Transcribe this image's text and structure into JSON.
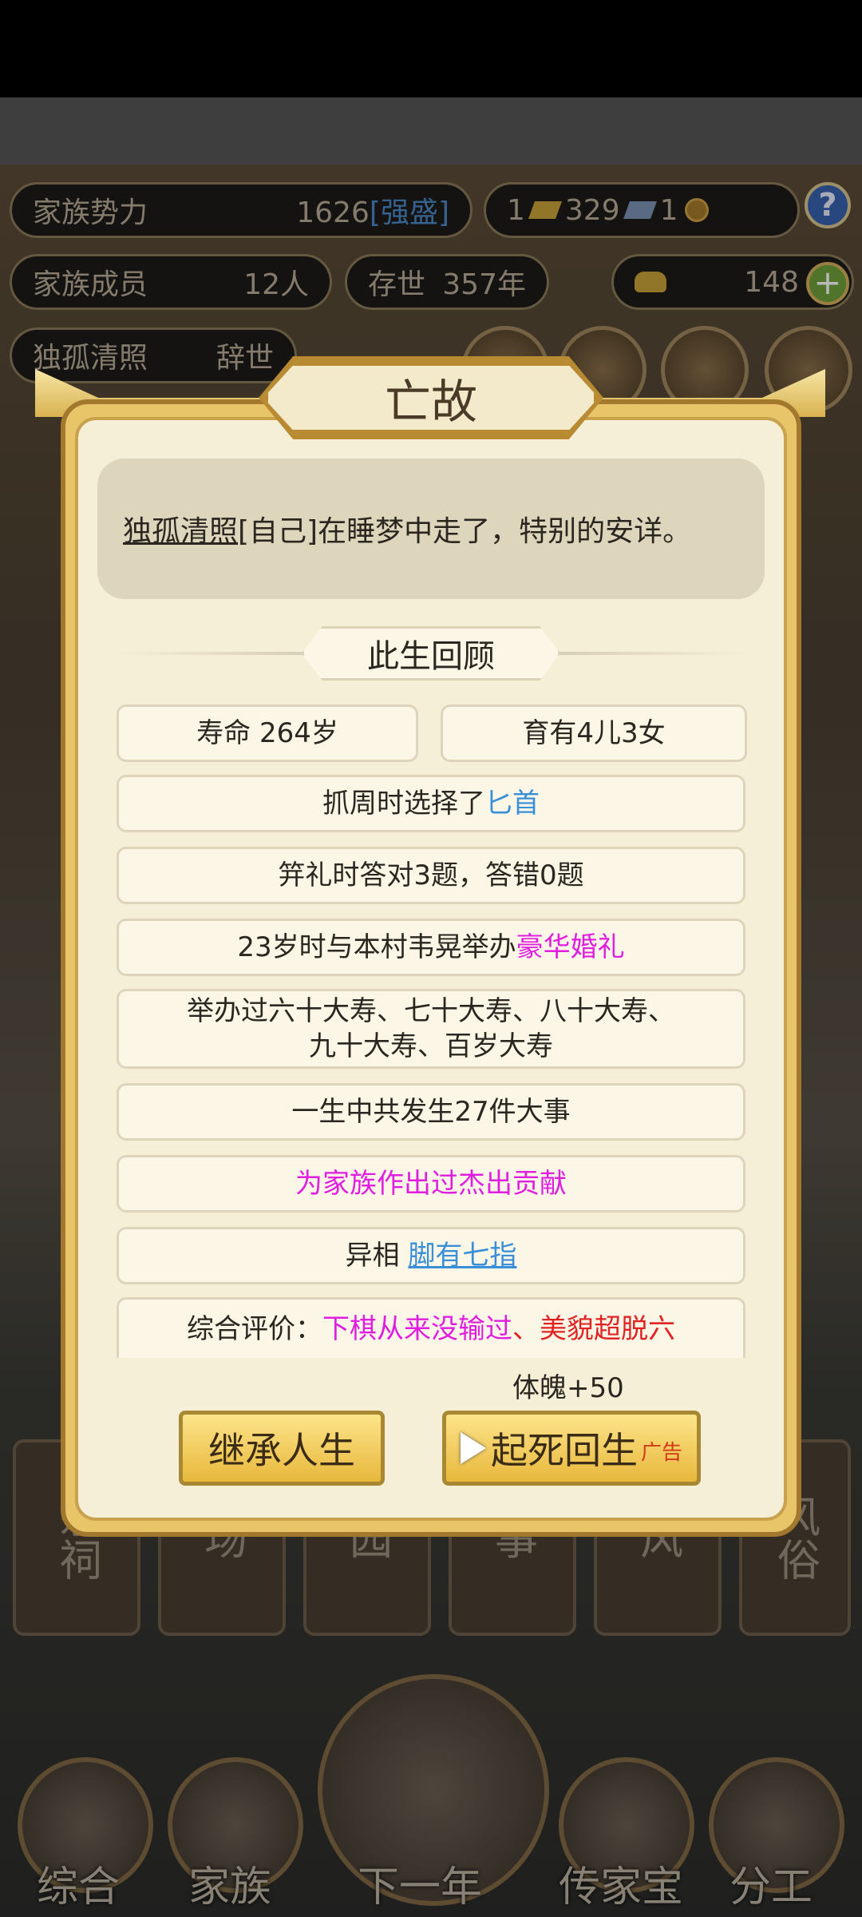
{
  "hud": {
    "family_power_label": "家族势力",
    "family_power_value": "1626",
    "family_power_rank": "[强盛]",
    "resources": [
      "1",
      "329",
      "1"
    ],
    "help": "?",
    "members_label": "家族成员",
    "members_value": "12人",
    "existence_label": "存世",
    "existence_value": "357年",
    "gold_value": "148",
    "person_name": "独孤清照",
    "person_status": "辞世"
  },
  "bottom_tiles": [
    "宗祠",
    "场",
    "园",
    "事",
    "风",
    "风俗"
  ],
  "nav": {
    "items": [
      "综合",
      "家族",
      "下一年",
      "传家宝",
      "分工"
    ]
  },
  "modal": {
    "title": "亡故",
    "death_name": "独孤清照",
    "death_text": "[自己]在睡梦中走了，特别的安详。",
    "review_title": "此生回顾",
    "lifespan": "寿命 264岁",
    "children": "育有4儿3女",
    "zhuazhou_prefix": "抓周时选择了",
    "zhuazhou_item": "匕首",
    "jili": "笄礼时答对3题，答错0题",
    "wedding_prefix": "23岁时与本村韦晃举办",
    "wedding_type": "豪华婚礼",
    "birthday_line1": "举办过六十大寿、七十大寿、八十大寿、",
    "birthday_line2": "九十大寿、百岁大寿",
    "events": "一生中共发生27件大事",
    "contribution": "为家族作出过杰出贡献",
    "trait_prefix": "异相",
    "trait": "脚有七指",
    "eval_prefix": "综合评价：",
    "eval_1": "下棋从来没输过",
    "eval_sep": "、",
    "eval_2": "美貌超脱六",
    "bonus": "体魄+50",
    "inherit_button": "继承人生",
    "revive_button": "起死回生",
    "ad_label": "广告"
  }
}
